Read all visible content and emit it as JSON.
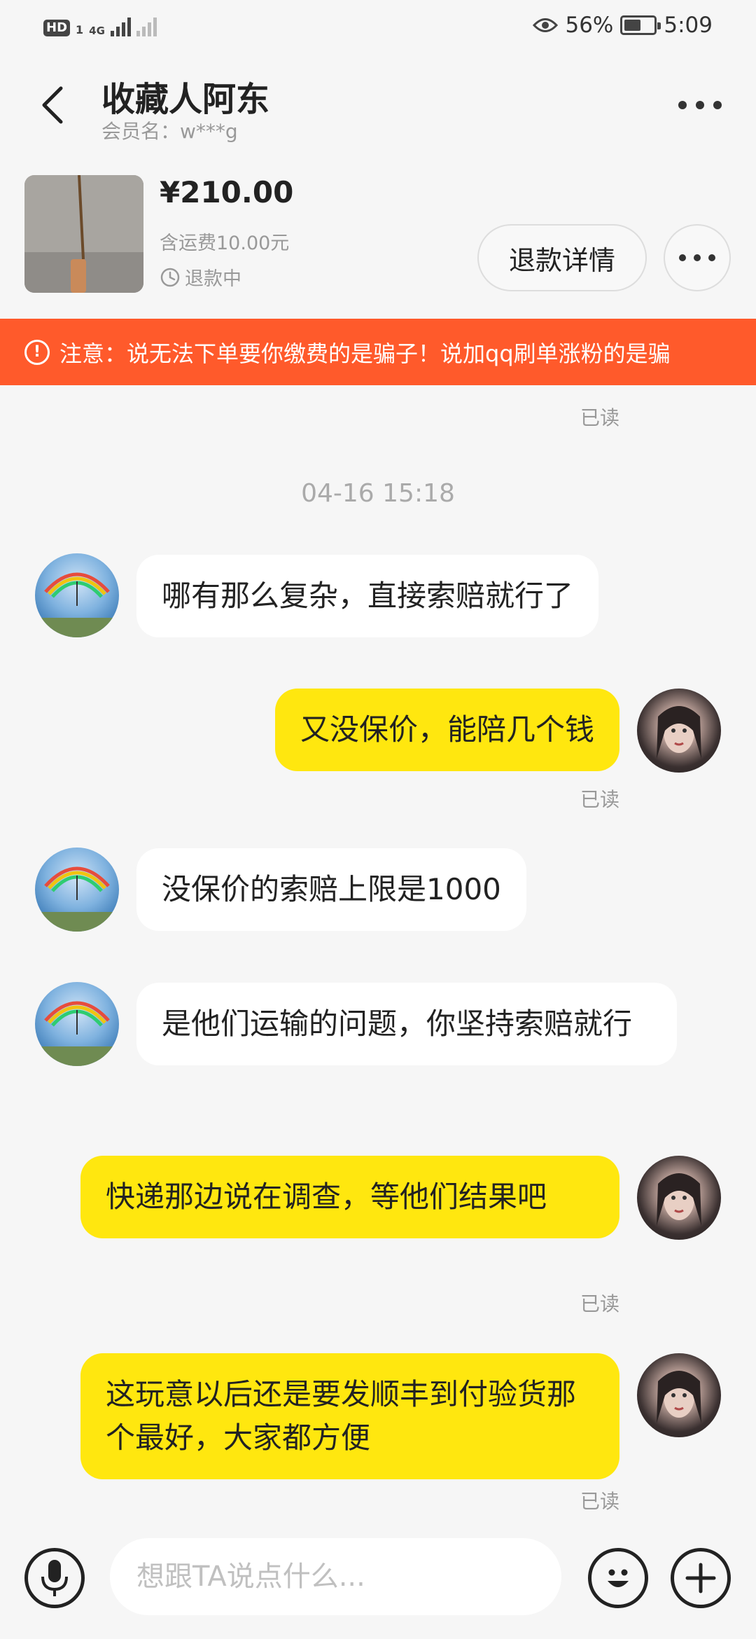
{
  "status_bar": {
    "hd_label": "HD",
    "sim_label": "1",
    "network_label": "4G",
    "battery_percent": "56%",
    "battery_level": 0.56,
    "time": "5:09"
  },
  "header": {
    "title": "收藏人阿东",
    "member": "会员名：w***g"
  },
  "order": {
    "price": "¥210.00",
    "shipping": "含运费10.00元",
    "status": "退款中",
    "refund_button": "退款详情"
  },
  "warning": {
    "text": "注意：说无法下单要你缴费的是骗子！说加qq刷单涨粉的是骗"
  },
  "chat": {
    "read_label": "已读",
    "timestamp": "04-16 15:18",
    "messages": [
      {
        "text": "哪有那么复杂，直接索赔就行了"
      },
      {
        "text": "又没保价，能陪几个钱"
      },
      {
        "text": "没保价的索赔上限是1000"
      },
      {
        "text": "是他们运输的问题，你坚持索赔就行"
      },
      {
        "text": "快递那边说在调查，等他们结果吧"
      },
      {
        "text": "这玩意以后还是要发顺丰到付验货那个最好，大家都方便"
      }
    ]
  },
  "input": {
    "placeholder": "想跟TA说点什么..."
  },
  "colors": {
    "warning_bg": "#ff5a2b",
    "my_bubble": "#ffe70f",
    "other_bubble": "#ffffff",
    "page_bg": "#f6f6f6"
  },
  "icons": {
    "back": "chevron-left-icon",
    "more": "more-dots-icon",
    "clock": "clock-icon",
    "warning": "exclamation-circle-icon",
    "mic": "microphone-icon",
    "emoji": "smiley-icon",
    "plus": "plus-icon"
  }
}
